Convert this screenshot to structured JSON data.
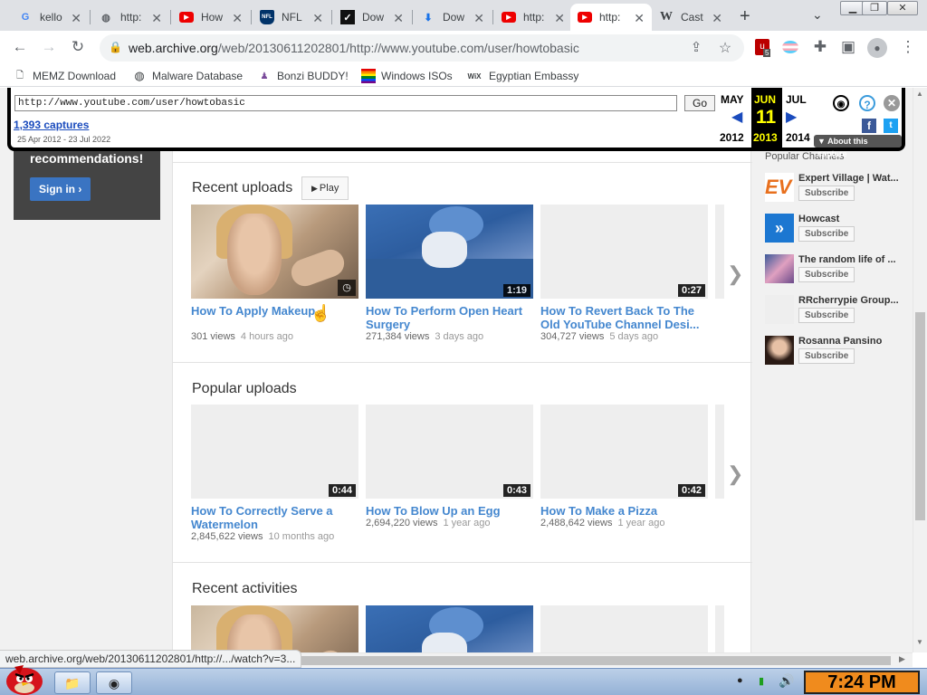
{
  "browser": {
    "tabs": [
      {
        "title": "kello",
        "icon": "google-icon"
      },
      {
        "title": "http:",
        "icon": "globe-icon"
      },
      {
        "title": "How",
        "icon": "youtube-icon"
      },
      {
        "title": "NFL",
        "icon": "nfl-icon"
      },
      {
        "title": "Dow",
        "icon": "download-site-icon"
      },
      {
        "title": "Dow",
        "icon": "download-arrow-icon"
      },
      {
        "title": "http:",
        "icon": "youtube-icon"
      },
      {
        "title": "http:",
        "icon": "youtube-icon"
      },
      {
        "title": "Cast",
        "icon": "wikipedia-icon"
      }
    ],
    "url_host": "web.archive.org",
    "url_path": "/web/20130611202801/http://www.youtube.com/user/howtobasic",
    "extension_badge": "5",
    "status_url": "web.archive.org/web/20130611202801/http://.../watch?v=3..."
  },
  "bookmarks": [
    {
      "label": "MEMZ Download",
      "icon": "memz-icon"
    },
    {
      "label": "Malware Database",
      "icon": "globe-icon"
    },
    {
      "label": "Bonzi BUDDY!",
      "icon": "bonzi-icon"
    },
    {
      "label": "Windows ISOs",
      "icon": "windows-flag-icon"
    },
    {
      "label": "Egyptian Embassy",
      "icon": "wix-icon"
    }
  ],
  "wayback": {
    "url_value": "http://www.youtube.com/user/howtobasic",
    "go_label": "Go",
    "captures_label": "1,393 captures",
    "date_range": "25 Apr 2012 - 23 Jul 2022",
    "prev_month": "MAY",
    "cur_month": "JUN",
    "next_month": "JUL",
    "cur_day": "11",
    "prev_year": "2012",
    "cur_year": "2013",
    "next_year": "2014",
    "about_label": "About this capture"
  },
  "left": {
    "message": "recommendations!",
    "signin_label": "Sign in ›"
  },
  "sections": {
    "recent_uploads": "Recent uploads",
    "play_label": "Play",
    "popular_uploads": "Popular uploads",
    "recent_activities": "Recent activities"
  },
  "recent_videos": [
    {
      "title": "How To Apply Makeup",
      "views": "301 views",
      "age": "4 hours ago",
      "duration": ""
    },
    {
      "title": "How To Perform Open Heart Surgery",
      "views": "271,384 views",
      "age": "3 days ago",
      "duration": "1:19"
    },
    {
      "title": "How To Revert Back To The Old YouTube Channel Desi...",
      "views": "304,727 views",
      "age": "5 days ago",
      "duration": "0:27"
    }
  ],
  "popular_videos": [
    {
      "title": "How To Correctly Serve a Watermelon",
      "views": "2,845,622 views",
      "age": "10 months ago",
      "duration": "0:44"
    },
    {
      "title": "How To Blow Up an Egg",
      "views": "2,694,220 views",
      "age": "1 year ago",
      "duration": "0:43"
    },
    {
      "title": "How To Make a Pizza",
      "views": "2,488,642 views",
      "age": "1 year ago",
      "duration": "0:42"
    }
  ],
  "sidebar": {
    "title": "Popular Channels",
    "subscribe_label": "Subscribe",
    "channels": [
      {
        "name": "Expert Village | Wat...",
        "logo": "EV"
      },
      {
        "name": "Howcast",
        "logo": "howcast-icon"
      },
      {
        "name": "The random life of ...",
        "logo": ""
      },
      {
        "name": "RRcherrypie Group...",
        "logo": ""
      },
      {
        "name": "Rosanna Pansino",
        "logo": ""
      }
    ]
  },
  "taskbar": {
    "clock": "7:24 PM"
  },
  "colors": {
    "link_blue": "#4487cf",
    "wayback_highlight": "#ffff00",
    "clock_bg": "#f08b1d"
  }
}
